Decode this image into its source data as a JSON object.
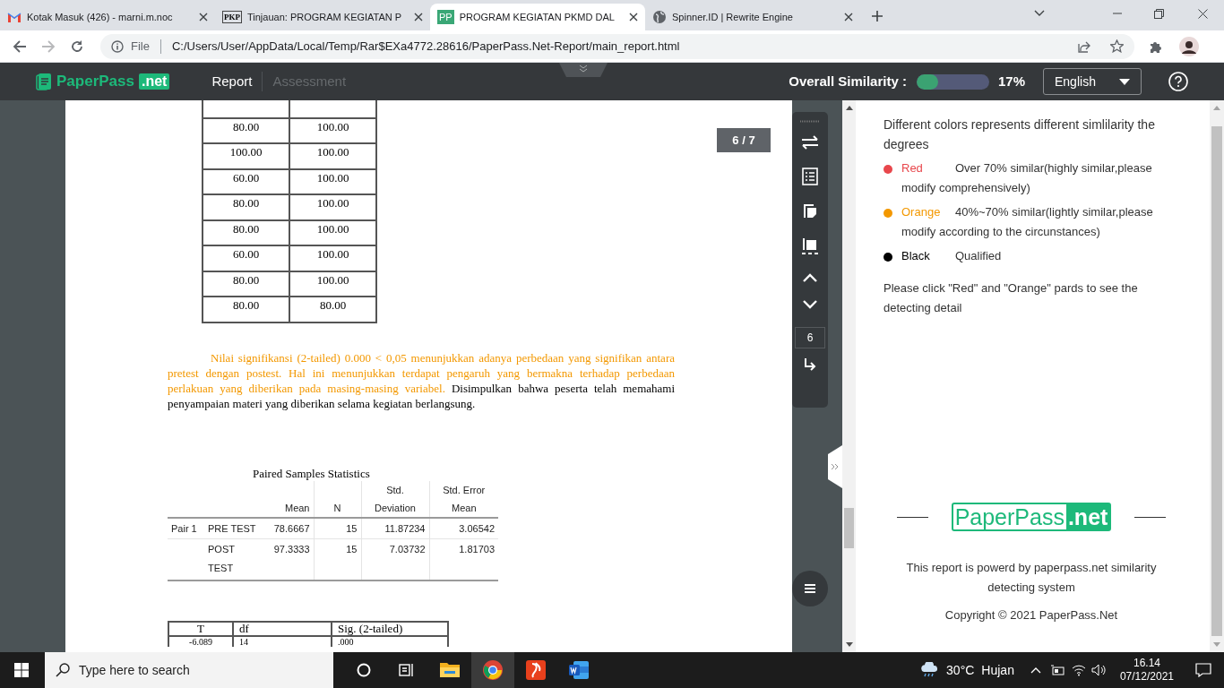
{
  "browser": {
    "tabs": [
      {
        "title": "Kotak Masuk (426) - marni.m.noc",
        "selected": false
      },
      {
        "title": "Tinjauan: PROGRAM KEGIATAN P",
        "selected": false
      },
      {
        "title": "PROGRAM KEGIATAN PKMD DAL",
        "selected": true
      },
      {
        "title": "Spinner.ID | Rewrite Engine",
        "selected": false
      }
    ],
    "pkp_mark": "PKP",
    "pp_mark": "PP",
    "address": {
      "scheme": "File",
      "url": "C:/Users/User/AppData/Local/Temp/Rar$EXa4772.28616/PaperPass.Net-Report/main_report.html"
    }
  },
  "app": {
    "brand": {
      "name": "PaperPass",
      "suffix": ".net"
    },
    "nav": [
      {
        "label": "Report",
        "selected": true
      },
      {
        "label": "Assessment",
        "selected": false
      }
    ],
    "similarity": {
      "label": "Overall Similarity :",
      "level": 0.3,
      "value": "17%"
    },
    "language": "English"
  },
  "document": {
    "page_badge": "6 / 7",
    "score_table": {
      "rows": [
        [
          "",
          ""
        ],
        [
          "80.00",
          "100.00"
        ],
        [
          "100.00",
          "100.00"
        ],
        [
          "60.00",
          "100.00"
        ],
        [
          "80.00",
          "100.00"
        ],
        [
          "80.00",
          "100.00"
        ],
        [
          "60.00",
          "100.00"
        ],
        [
          "80.00",
          "100.00"
        ],
        [
          "80.00",
          "80.00"
        ]
      ]
    },
    "paragraph": [
      {
        "text": "Nilai signifikansi (2-tailed) 0.000 < 0,05 menunjukkan adanya perbedaan yang signifikan antara pretest dengan postest. Hal ini menunjukkan  terdapat pengaruh yang bermakna terhadap perbedaan perlakuan yang diberikan pada masing-masing  variabel.",
        "color": "#f39800"
      },
      {
        "text": "Disimpulkan  bahwa peserta telah memahami penyampaian materi yang diberikan selama kegiatan berlangsung.",
        "color": "#000000"
      }
    ],
    "stats_table": {
      "title": "Paired Samples Statistics",
      "header_rows": [
        [
          "",
          "",
          "",
          "",
          "Std.",
          "Std. Error"
        ],
        [
          "",
          "",
          "Mean",
          "N",
          "Deviation",
          "Mean"
        ]
      ],
      "rows": [
        [
          "Pair 1",
          "PRE TEST",
          "78.6667",
          "15",
          "11.87234",
          "3.06542"
        ],
        [
          "",
          "POST TEST",
          "97.3333",
          "15",
          "7.03732",
          "1.81703"
        ]
      ]
    },
    "test_table": {
      "columns": [
        "T",
        "df",
        "Sig. (2-tailed)"
      ],
      "rows": [
        [
          "-6.089",
          "14",
          ".000"
        ]
      ]
    }
  },
  "toolbar": {
    "page_input": "6"
  },
  "legend_panel": {
    "heading": "Different colors represents different simlilarity the degrees",
    "items": [
      {
        "name": "Red",
        "color": "#e8474c",
        "description": "Over 70% similar(highly similar,please modify comprehensively)"
      },
      {
        "name": "Orange",
        "color": "#f39800",
        "description": "40%~70% similar(lightly similar,please modify according to the circunstances)"
      },
      {
        "name": "Black",
        "color": "#000000",
        "description": "Qualified"
      }
    ],
    "note": "Please click \"Red\" and \"Orange\" pards to see the detecting detail",
    "logo": {
      "name": "PaperPass",
      "suffix": ".net"
    },
    "powered": "This report is powerd by paperpass.net similarity detecting system",
    "copyright": "Copyright © 2021 PaperPass.Net"
  },
  "taskbar": {
    "search_placeholder": "Type here to search",
    "weather": {
      "temperature": "30°C",
      "condition": "Hujan"
    },
    "time": "16.14",
    "date": "07/12/2021"
  }
}
